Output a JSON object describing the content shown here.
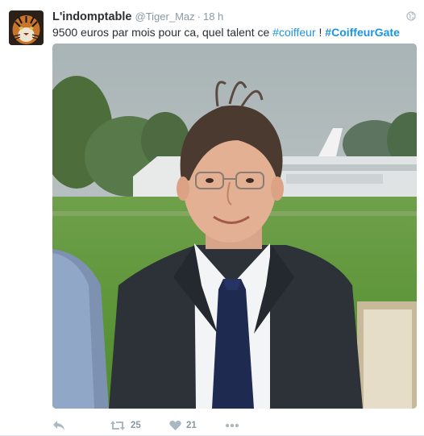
{
  "tweet": {
    "author_name": "L'indomptable",
    "author_handle": "@Tiger_Maz",
    "separator": "·",
    "time": "18 h",
    "text_before": "9500 euros par mois pour ca, quel talent ce ",
    "hashtag1": "#coiffeur",
    "text_middle": " ! ",
    "hashtag2": "#CoiffeurGate"
  },
  "actions": {
    "retweet_count": "25",
    "like_count": "21"
  },
  "colors": {
    "link": "#1b95e0",
    "meta": "#8899a6",
    "icon": "#aab8c2"
  }
}
